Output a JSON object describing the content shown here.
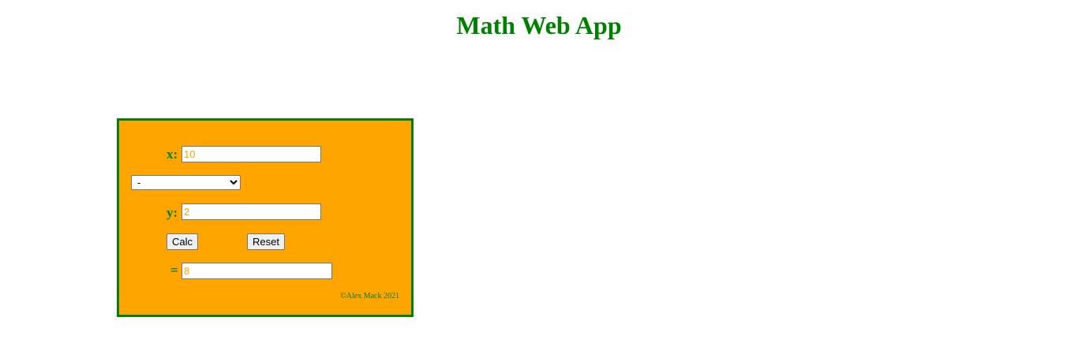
{
  "page": {
    "title": "Math Web App"
  },
  "form": {
    "x_label": "x:",
    "x_value": "10",
    "operator_value": "-",
    "operator_options": [
      "-"
    ],
    "y_label": "y:",
    "y_value": "2",
    "calc_label": "Calc",
    "reset_label": "Reset",
    "result_label": "=",
    "result_value": "8"
  },
  "footer": {
    "credit": "©Alex Mack 2021"
  },
  "colors": {
    "title": "#008000",
    "panel_background": "#FFA500",
    "panel_border": "#008000",
    "input_text": "#FFA500"
  }
}
